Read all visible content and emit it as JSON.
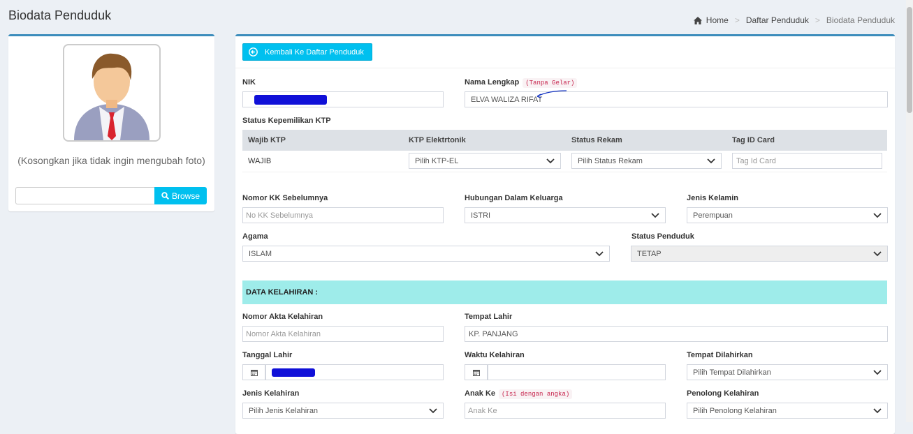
{
  "page": {
    "title": "Biodata Penduduk"
  },
  "breadcrumb": {
    "home": "Home",
    "list": "Daftar Penduduk",
    "current": "Biodata Penduduk",
    "separator": ">"
  },
  "photo": {
    "hint": "(Kosongkan jika tidak ingin mengubah foto)",
    "browse_label": "Browse"
  },
  "form": {
    "back_label": "Kembali Ke Daftar Penduduk",
    "nik": {
      "label": "NIK",
      "value": ""
    },
    "nama": {
      "label": "Nama Lengkap",
      "hint": "(Tanpa Gelar)",
      "value": "ELVA WALIZA RIFAT"
    },
    "status_ktp": {
      "label": "Status Kepemilikan KTP",
      "headers": [
        "Wajib KTP",
        "KTP Elektrtonik",
        "Status Rekam",
        "Tag ID Card"
      ],
      "wajib_value": "WAJIB",
      "ktp_el_value": "Pilih KTP-EL",
      "status_rekam_value": "Pilih Status Rekam",
      "tag_placeholder": "Tag Id Card"
    },
    "kk_sebelumnya": {
      "label": "Nomor KK Sebelumnya",
      "placeholder": "No KK Sebelumnya"
    },
    "hubungan": {
      "label": "Hubungan Dalam Keluarga",
      "value": "ISTRI"
    },
    "jenis_kelamin": {
      "label": "Jenis Kelamin",
      "value": "Perempuan"
    },
    "agama": {
      "label": "Agama",
      "value": "ISLAM"
    },
    "status_penduduk": {
      "label": "Status Penduduk",
      "value": "TETAP"
    },
    "section_kelahiran": "DATA KELAHIRAN :",
    "akta": {
      "label": "Nomor Akta Kelahiran",
      "placeholder": "Nomor Akta Kelahiran"
    },
    "tempat_lahir": {
      "label": "Tempat Lahir",
      "value": "KP. PANJANG"
    },
    "tanggal_lahir": {
      "label": "Tanggal Lahir",
      "value": ""
    },
    "waktu_kelahiran": {
      "label": "Waktu Kelahiran",
      "value": ""
    },
    "tempat_dilahirkan": {
      "label": "Tempat Dilahirkan",
      "value": "Pilih Tempat Dilahirkan"
    },
    "jenis_kelahiran": {
      "label": "Jenis Kelahiran",
      "value": "Pilih Jenis Kelahiran"
    },
    "anak_ke": {
      "label": "Anak Ke",
      "hint": "(Isi dengan angka)",
      "placeholder": "Anak Ke"
    },
    "penolong": {
      "label": "Penolong Kelahiran",
      "value": "Pilih Penolong Kelahiran"
    }
  },
  "icons": [
    "home-icon",
    "back-arrow-icon",
    "search-icon",
    "calendar-icon",
    "chevron-down-icon",
    "user-avatar-icon"
  ],
  "colors": {
    "primary_border": "#3c8dbc",
    "info_button": "#00c0ef",
    "section_band": "#9eecea",
    "hint_code": "#c7254e"
  }
}
